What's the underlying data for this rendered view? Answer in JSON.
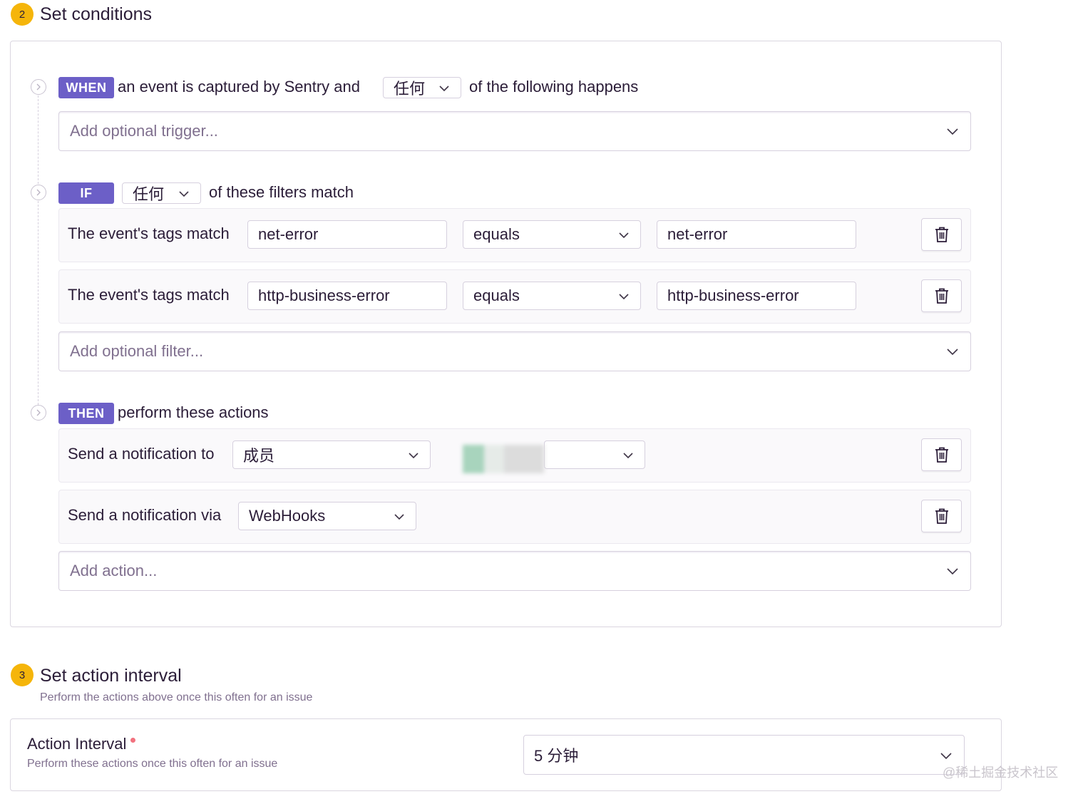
{
  "step2": {
    "number": "2",
    "title": "Set conditions"
  },
  "when": {
    "pill": "WHEN",
    "text_before": "an event is captured by Sentry and",
    "match_select": "任何",
    "text_after": "of the following happens",
    "add_trigger_placeholder": "Add optional trigger..."
  },
  "if": {
    "pill": "IF",
    "match_select": "任何",
    "text_after": "of these filters match",
    "filters": [
      {
        "label": "The event's tags match",
        "key": "net-error",
        "operator": "equals",
        "value": "net-error"
      },
      {
        "label": "The event's tags match",
        "key": "http-business-error",
        "operator": "equals",
        "value": "http-business-error"
      }
    ],
    "add_filter_placeholder": "Add optional filter..."
  },
  "then": {
    "pill": "THEN",
    "text_after": "perform these actions",
    "actions": [
      {
        "label": "Send a notification to",
        "target": "成员"
      },
      {
        "label": "Send a notification via",
        "service": "WebHooks"
      }
    ],
    "add_action_placeholder": "Add action..."
  },
  "step3": {
    "number": "3",
    "title": "Set action interval",
    "subtitle": "Perform the actions above once this often for an issue"
  },
  "interval": {
    "label": "Action Interval",
    "help": "Perform these actions once this often for an issue",
    "value": "5 分钟"
  },
  "watermark": "@稀土掘金技术社区",
  "colors": {
    "accent": "#6c5fc7",
    "badge": "#f5b50a",
    "required": "#f2727f"
  }
}
